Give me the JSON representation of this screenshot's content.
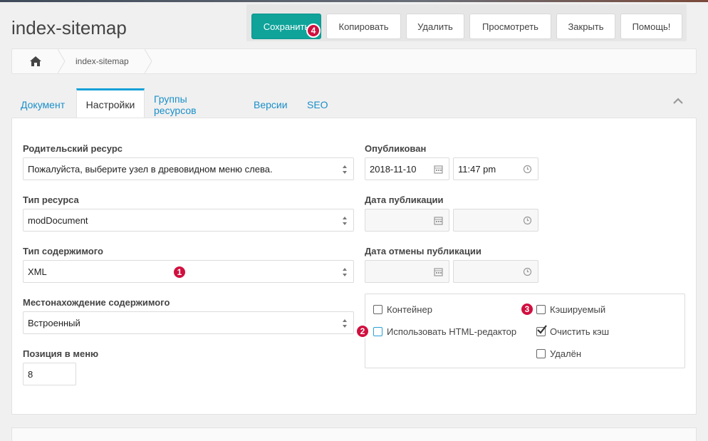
{
  "page": {
    "title": "index-sitemap"
  },
  "toolbar": {
    "buttons": [
      {
        "label": "Сохранить"
      },
      {
        "label": "Копировать"
      },
      {
        "label": "Удалить"
      },
      {
        "label": "Просмотреть"
      },
      {
        "label": "Закрыть"
      },
      {
        "label": "Помощь!"
      }
    ]
  },
  "breadcrumb": {
    "current": "index-sitemap"
  },
  "tabs": [
    {
      "label": "Документ"
    },
    {
      "label": "Настройки"
    },
    {
      "label": "Группы ресурсов"
    },
    {
      "label": "Версии"
    },
    {
      "label": "SEO"
    }
  ],
  "form": {
    "parent": {
      "label": "Родительский ресурс",
      "value": "Пожалуйста, выберите узел в древовидном меню слева."
    },
    "type": {
      "label": "Тип ресурса",
      "value": "modDocument"
    },
    "content_type": {
      "label": "Тип содержимого",
      "value": "XML"
    },
    "disposition": {
      "label": "Местонахождение содержимого",
      "value": "Встроенный"
    },
    "menuindex": {
      "label": "Позиция в меню",
      "value": "8"
    },
    "published": {
      "label": "Опубликован",
      "date": "2018-11-10",
      "time": "11:47 pm"
    },
    "pub_date": {
      "label": "Дата публикации",
      "date": "",
      "time": ""
    },
    "unpub_date": {
      "label": "Дата отмены публикации",
      "date": "",
      "time": ""
    }
  },
  "checkboxes": {
    "container": {
      "label": "Контейнер",
      "checked": false
    },
    "richtext": {
      "label": "Использовать HTML-редактор",
      "checked": false
    },
    "cacheable": {
      "label": "Кэшируемый",
      "checked": false
    },
    "syncsite": {
      "label": "Очистить кэш",
      "checked": true
    },
    "deleted": {
      "label": "Удалён",
      "checked": false
    }
  },
  "badges": [
    "1",
    "2",
    "3",
    "4"
  ],
  "colors": {
    "primary": "#0fa39a",
    "accent": "#17a0d8",
    "badge": "#d0103f"
  }
}
